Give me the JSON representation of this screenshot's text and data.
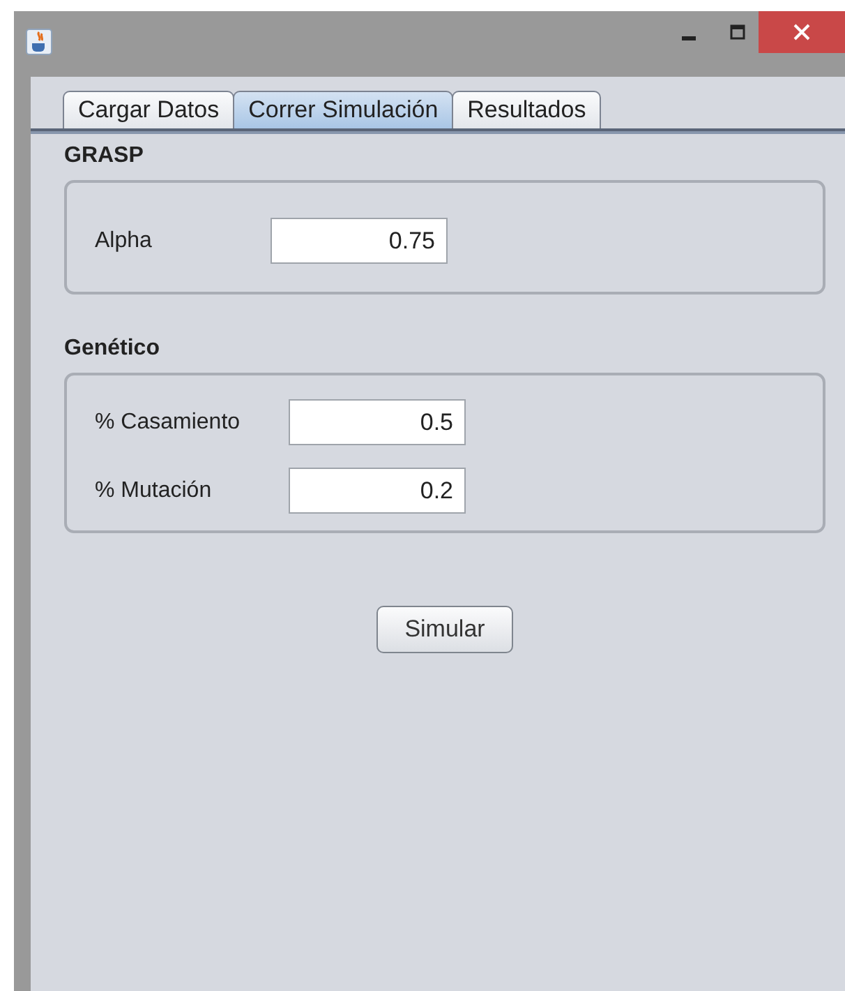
{
  "window": {
    "controls": [
      {
        "kind": "minimize"
      },
      {
        "kind": "maximize"
      },
      {
        "kind": "close"
      }
    ]
  },
  "tabs": [
    {
      "label": "Cargar Datos",
      "selected": false
    },
    {
      "label": "Correr Simulación",
      "selected": true
    },
    {
      "label": "Resultados",
      "selected": false
    }
  ],
  "groups": [
    {
      "title": "GRASP",
      "fields": [
        {
          "label": "Alpha",
          "value": "0.75"
        }
      ]
    },
    {
      "title": "Genético",
      "fields": [
        {
          "label": "% Casamiento",
          "value": "0.5"
        },
        {
          "label": "% Mutación",
          "value": "0.2"
        }
      ]
    }
  ],
  "button": "Simular"
}
